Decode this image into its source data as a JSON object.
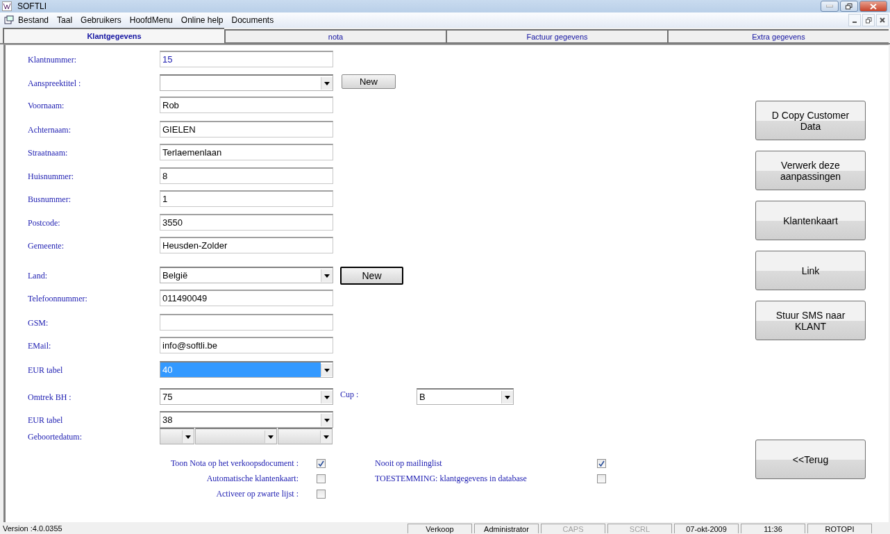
{
  "window": {
    "title": "SOFTLI"
  },
  "menu": [
    "Bestand",
    "Taal",
    "Gebruikers",
    "HoofdMenu",
    "Online help",
    "Documents"
  ],
  "tabs": [
    {
      "label": "Klantgegevens",
      "selected": true
    },
    {
      "label": "nota",
      "selected": false
    },
    {
      "label": "Factuur gegevens",
      "selected": false
    },
    {
      "label": "Extra gegevens",
      "selected": false
    }
  ],
  "fields": [
    {
      "label": "Klantnummer:",
      "kind": "text",
      "value": "15",
      "focused": false,
      "accent": true
    },
    {
      "label": "Aanspreektitel :",
      "kind": "select",
      "focused": false,
      "button": {
        "label": "New",
        "default": false
      }
    },
    {
      "label": "Voornaam:",
      "kind": "text",
      "value": "Rob",
      "focused": false
    },
    {
      "label": "Achternaam:",
      "kind": "text",
      "value": "GIELEN",
      "focused": false
    },
    {
      "label": "Straatnaam:",
      "kind": "text",
      "value": "Terlaemenlaan",
      "focused": false
    },
    {
      "label": "Huisnummer:",
      "kind": "text",
      "value": "8",
      "focused": false
    },
    {
      "label": "Busnummer:",
      "kind": "text",
      "value": "1",
      "focused": false
    },
    {
      "label": "Postcode:",
      "kind": "text",
      "value": "3550",
      "focused": false
    },
    {
      "label": "Gemeente:",
      "kind": "text",
      "value": "Heusden-Zolder",
      "focused": false
    },
    {
      "label": "Land:",
      "kind": "select",
      "value": "België",
      "focused": false,
      "button": {
        "label": "New",
        "default": true
      }
    },
    {
      "label": "Telefoonnummer:",
      "kind": "text",
      "value": "011490049",
      "focused": false
    },
    {
      "label": "GSM:",
      "kind": "text",
      "focused": false
    },
    {
      "label": "EMail:",
      "kind": "text",
      "value": "info@softli.be",
      "focused": false
    },
    {
      "label": "EUR tabel",
      "kind": "select",
      "value": "40",
      "focused": true
    },
    {
      "label": "Omtrek BH :",
      "kind": "select",
      "value": "75",
      "focused": false,
      "side": {
        "label": "Cup :",
        "value": "B"
      }
    },
    {
      "label": "EUR tabel",
      "kind": "select",
      "value": "38",
      "focused": false
    },
    {
      "label": "Geboortedatum:",
      "kind": "date"
    }
  ],
  "options_left": [
    {
      "label": "Toon Nota op het verkoopsdocument :",
      "checked": true
    },
    {
      "label": "Automatische klantenkaart:",
      "checked": false
    },
    {
      "label": "Activeer op zwarte lijst :",
      "checked": false
    }
  ],
  "options_right": [
    {
      "label": "Nooit op mailinglist",
      "checked": true
    },
    {
      "label": "TOESTEMMING: klantgegevens in database",
      "checked": false
    }
  ],
  "actions": [
    "D  Copy Customer Data",
    "Verwerk deze aanpassingen",
    "Klantenkaart",
    "Link",
    "Stuur SMS naar KLANT"
  ],
  "back_button": "<<Terug",
  "status_bar": {
    "version": "Version :4.0.0355",
    "panels": [
      {
        "text": "Verkoop",
        "disabled": false
      },
      {
        "text": "Administrator",
        "disabled": false
      },
      {
        "text": "CAPS",
        "disabled": true
      },
      {
        "text": "SCRL",
        "disabled": true
      },
      {
        "text": "07-okt-2009",
        "disabled": false
      },
      {
        "text": "11:36",
        "disabled": false
      },
      {
        "text": "ROTOPI",
        "disabled": false
      }
    ]
  }
}
